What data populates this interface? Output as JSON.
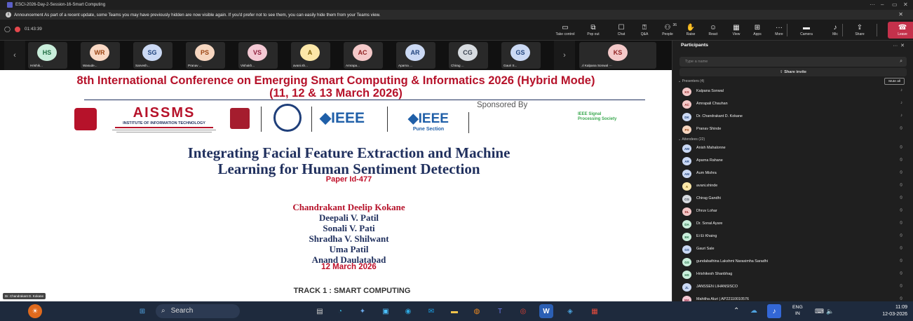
{
  "window": {
    "title": "ESCI-2026-Day-2-Session-16-Smart Computing",
    "more": "···",
    "minimize": "–",
    "maximize": "▭",
    "close": "✕"
  },
  "announcement": {
    "text": "Announcement As part of a recent update, some Teams you may have previously hidden are now visible again. If you'd prefer not to see them, you can easily hide them from your Teams view.",
    "close": "✕"
  },
  "meeting": {
    "timer": "01:43:39"
  },
  "toolbar": [
    {
      "label": "Take control",
      "icon": "▭"
    },
    {
      "label": "Pop out",
      "icon": "⧉"
    },
    {
      "label": "Chat",
      "icon": "☐"
    },
    {
      "label": "Q&A",
      "icon": "⍰"
    },
    {
      "label": "People",
      "icon": "⚇",
      "badge": "36"
    },
    {
      "label": "Raise",
      "icon": "✋"
    },
    {
      "label": "React",
      "icon": "☺"
    },
    {
      "label": "View",
      "icon": "▦"
    },
    {
      "label": "Apps",
      "icon": "⊞"
    },
    {
      "label": "More",
      "icon": "···"
    },
    {
      "label": "Camera",
      "icon": "▬"
    },
    {
      "label": "Mic",
      "icon": "♪"
    },
    {
      "label": "Share",
      "icon": "⇪"
    },
    {
      "label": "Leave",
      "icon": "☎"
    }
  ],
  "strip": {
    "prev": "‹",
    "next": "›",
    "tiles": [
      {
        "initials": "HS",
        "name": "Hrishik...",
        "bg": "#c9eedb",
        "fg": "#1e6b40"
      },
      {
        "initials": "WR",
        "name": "Wasudе...",
        "bg": "#f9d8c4",
        "fg": "#9b4513"
      },
      {
        "initials": "SG",
        "name": "Sarvesh...",
        "bg": "#cbd9f4",
        "fg": "#22457e"
      },
      {
        "initials": "PS",
        "name": "Pranav ...",
        "bg": "#f6d6c0",
        "fg": "#9b4513"
      },
      {
        "initials": "VS",
        "name": "Vishakh...",
        "bg": "#f4c9d4",
        "fg": "#8e1f3c"
      },
      {
        "initials": "A",
        "name": "avani.sh...",
        "bg": "#fce7a8",
        "fg": "#7a5b00"
      },
      {
        "initials": "AC",
        "name": "Amrapa...",
        "bg": "#f4c9c9",
        "fg": "#8e1f1f"
      },
      {
        "initials": "AR",
        "name": "Aparna ...",
        "bg": "#cbd9f4",
        "fg": "#22457e"
      },
      {
        "initials": "CG",
        "name": "Chirag ...",
        "bg": "#d7dbe0",
        "fg": "#3b4350"
      },
      {
        "initials": "GS",
        "name": "Gauri S...",
        "bg": "#cbd9f4",
        "fg": "#22457e"
      }
    ],
    "self": {
      "initials": "KS",
      "name": ".ıl Kalpana Sonwal",
      "bg": "#f4c9c9",
      "fg": "#8e1f1f",
      "more": "···"
    }
  },
  "slide": {
    "conference_line1": "8th International Conference on Emerging Smart Computing & Informatics 2026 (Hybrid Mode)",
    "conference_line2": "(11, 12 & 13 March 2026)",
    "logo_aissms": "AISSMS",
    "logo_aissms_sub": "INSTITUTE OF INFORMATION TECHNOLOGY",
    "sponsored_by": "Sponsored By",
    "ieee": "IEEE",
    "ieee_pune": "Pune Section",
    "ieee_sps": "IEEE Signal Processing Society",
    "title_line1": "Integrating Facial Feature Extraction and Machine",
    "title_line2": "Learning for Human Sentiment Detection",
    "paper_id": "Paper Id-477",
    "authors": [
      "Chandrakant Deelip Kokane",
      "Deepali V. Patil",
      "Sonali V. Pati",
      "Shradha V. Shilwant",
      "Uma Patil",
      "Anand Daulatabad"
    ],
    "date": "12 March 2026",
    "track": "TRACK 1 : SMART COMPUTING",
    "presenter_label": "Dr. Chandrakant D. Kokane"
  },
  "participants": {
    "title": "Participants",
    "more": "···",
    "close": "✕",
    "search_placeholder": "Type a name",
    "share_invite": "Share invite",
    "presenters_header": "Presenters (4)",
    "mute_all": "Mute all",
    "presenters": [
      {
        "initials": "KS",
        "name": "Kalpana Sonwal",
        "bg": "#f4c9c9",
        "fg": "#8e1f1f",
        "mic": "♪"
      },
      {
        "initials": "AC",
        "name": "Amrapali Chauhan",
        "bg": "#f4c9c9",
        "fg": "#8e1f1f",
        "mic": "♪"
      },
      {
        "initials": "DK",
        "name": "Dr. Chandrakant D. Kokane",
        "bg": "#cbd9f4",
        "fg": "#22457e",
        "mic": "♪"
      },
      {
        "initials": "PS",
        "name": "Pranav Shinde",
        "bg": "#f6d6c0",
        "fg": "#9b4513",
        "mic": "⦸"
      }
    ],
    "attendees_header": "Attendees (22)",
    "attendees": [
      {
        "initials": "AM",
        "name": "Anish Mahalоnne",
        "bg": "#cbd9f4",
        "fg": "#22457e"
      },
      {
        "initials": "AR",
        "name": "Aparna Rahane",
        "bg": "#cbd9f4",
        "fg": "#22457e"
      },
      {
        "initials": "AM",
        "name": "Aum Mishra",
        "bg": "#cbd9f4",
        "fg": "#22457e"
      },
      {
        "initials": "A",
        "name": "avani.shinde",
        "bg": "#fce7a8",
        "fg": "#7a5b00"
      },
      {
        "initials": "CG",
        "name": "Chirag Gandhi",
        "bg": "#d7dbe0",
        "fg": "#3b4350"
      },
      {
        "initials": "DL",
        "name": "Dhruv Lohar",
        "bg": "#f4c9c9",
        "fg": "#8e1f1f"
      },
      {
        "initials": "DA",
        "name": "Dr. Sonal Ayare",
        "bg": "#c9eedb",
        "fg": "#1e6b40"
      },
      {
        "initials": "EK",
        "name": "Ei Ei Khaing",
        "bg": "#c9eedb",
        "fg": "#1e6b40"
      },
      {
        "initials": "GS",
        "name": "Gauri Sale",
        "bg": "#cbd9f4",
        "fg": "#22457e"
      },
      {
        "initials": "GS",
        "name": "gundabathina Lakshmi Narasimha Saradhi",
        "bg": "#c9eedb",
        "fg": "#1e6b40"
      },
      {
        "initials": "HS",
        "name": "Hrishikesh Shanbhag",
        "bg": "#c9eedb",
        "fg": "#1e6b40"
      },
      {
        "initials": "JL",
        "name": "JANSSEN LIHANSISCO",
        "bg": "#cbd9f4",
        "fg": "#22457e"
      },
      {
        "initials": "MA",
        "name": "Mahitha Aluri | AP22110010576",
        "bg": "#f4c9d4",
        "fg": "#8e1f3c"
      }
    ],
    "attendee_mic": "⦸"
  },
  "taskbar": {
    "search": "Search",
    "lang_top": "ENG",
    "lang_bottom": "IN",
    "time": "11:09",
    "date": "12-03-2026"
  }
}
